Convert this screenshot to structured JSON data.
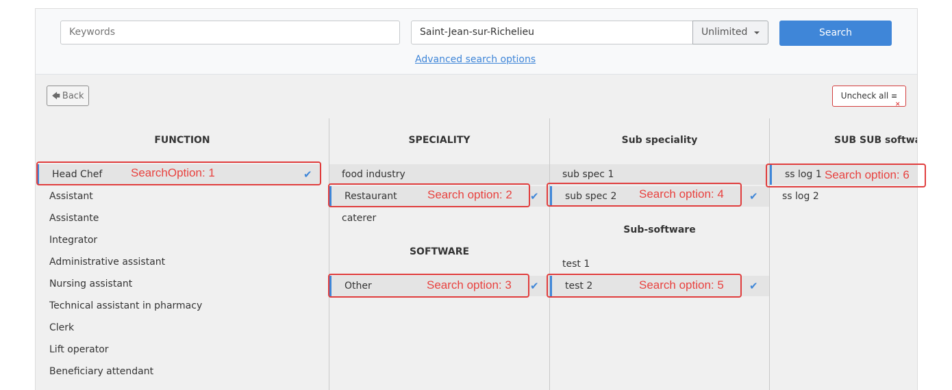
{
  "search": {
    "keywords_placeholder": "Keywords",
    "location_value": "Saint-Jean-sur-Richelieu",
    "radius_value": "Unlimited",
    "search_label": "Search",
    "advanced_label": "Advanced search options"
  },
  "toolbar": {
    "back_label": "Back",
    "uncheck_label": "Uncheck all"
  },
  "columns": {
    "function": {
      "heading": "FUNCTION",
      "items": [
        "Head Chef",
        "Assistant",
        "Assistante",
        "Integrator",
        "Administrative assistant",
        "Nursing assistant",
        "Technical assistant in pharmacy",
        "Clerk",
        "Lift operator",
        "Beneficiary attendant"
      ],
      "selected": "Head Chef"
    },
    "speciality": {
      "heading": "SPECIALITY",
      "items": [
        "food industry",
        "Restaurant",
        "caterer"
      ],
      "selected": "Restaurant"
    },
    "software": {
      "heading": "SOFTWARE",
      "items": [
        "Other"
      ],
      "selected": "Other"
    },
    "sub_speciality": {
      "heading": "Sub speciality",
      "items": [
        "sub spec 1",
        "sub spec 2"
      ],
      "selected": "sub spec 2"
    },
    "sub_software": {
      "heading": "Sub-software",
      "items": [
        "test 1",
        "test 2"
      ],
      "selected": "test 2"
    },
    "sub_sub_software": {
      "heading": "SUB SUB softwar",
      "items": [
        "ss log 1",
        "ss log 2"
      ],
      "selected": "ss log 1"
    }
  },
  "annotations": [
    "SearchOption: 1",
    "Search option: 2",
    "Search option: 3",
    "Search option: 4",
    "Search option: 5",
    "Search option: 6"
  ],
  "colors": {
    "accent": "#3f86d8",
    "annotation": "#e03c3c",
    "danger_border": "#d33d3d"
  },
  "icons": {
    "back": "arrow-left-icon",
    "uncheck": "clear-list-icon",
    "check": "checkmark-icon",
    "dropdown": "caret-down-icon"
  }
}
